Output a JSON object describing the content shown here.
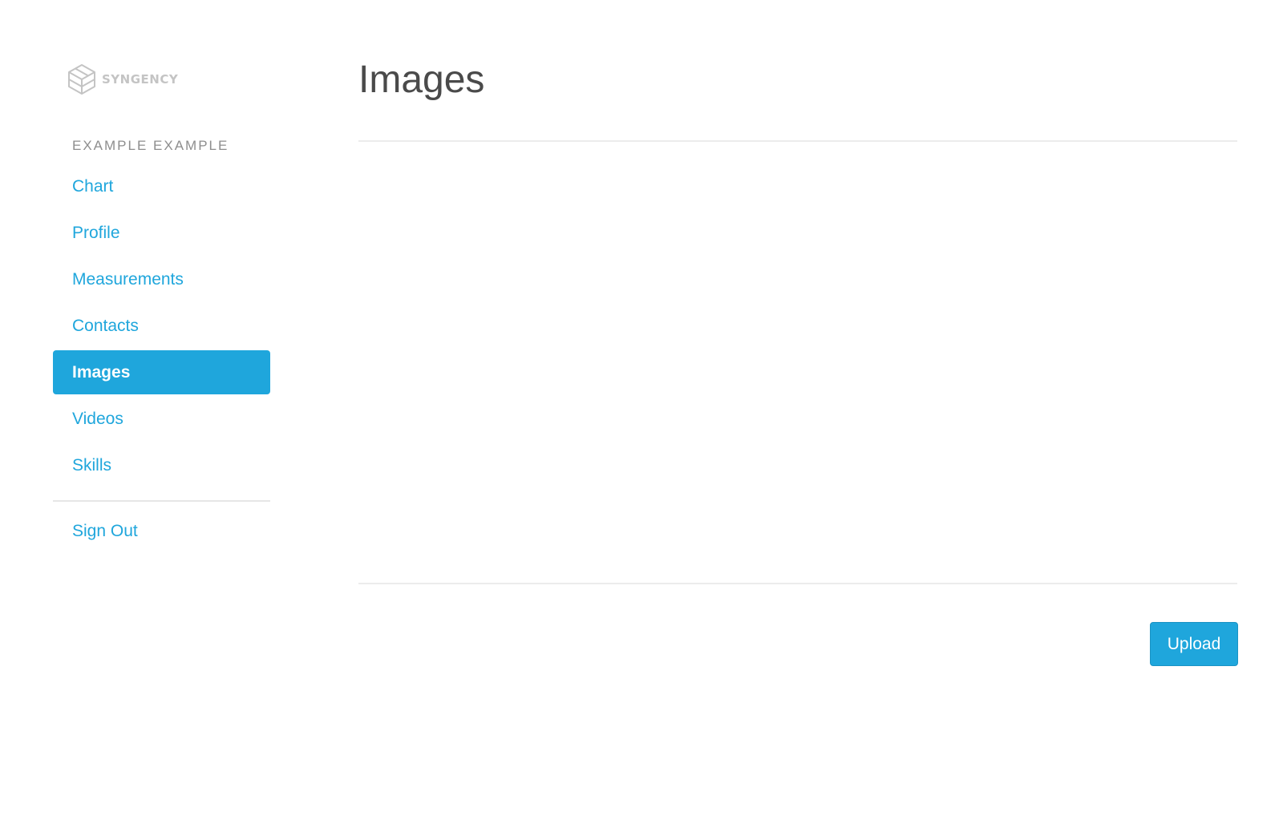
{
  "brand": {
    "name": "SYNGENCY",
    "logo_icon": "cube-logo-icon",
    "logo_color": "#c4c4c4"
  },
  "user": {
    "name": "EXAMPLE EXAMPLE"
  },
  "sidebar": {
    "items": [
      {
        "label": "Chart",
        "active": false
      },
      {
        "label": "Profile",
        "active": false
      },
      {
        "label": "Measurements",
        "active": false
      },
      {
        "label": "Contacts",
        "active": false
      },
      {
        "label": "Images",
        "active": true
      },
      {
        "label": "Videos",
        "active": false
      },
      {
        "label": "Skills",
        "active": false
      }
    ],
    "sign_out_label": "Sign Out"
  },
  "main": {
    "title": "Images",
    "upload_label": "Upload"
  },
  "colors": {
    "accent": "#1fa6dc",
    "title_text": "#4a4a4a",
    "muted_text": "#8e8e8e",
    "divider": "#ececec"
  }
}
